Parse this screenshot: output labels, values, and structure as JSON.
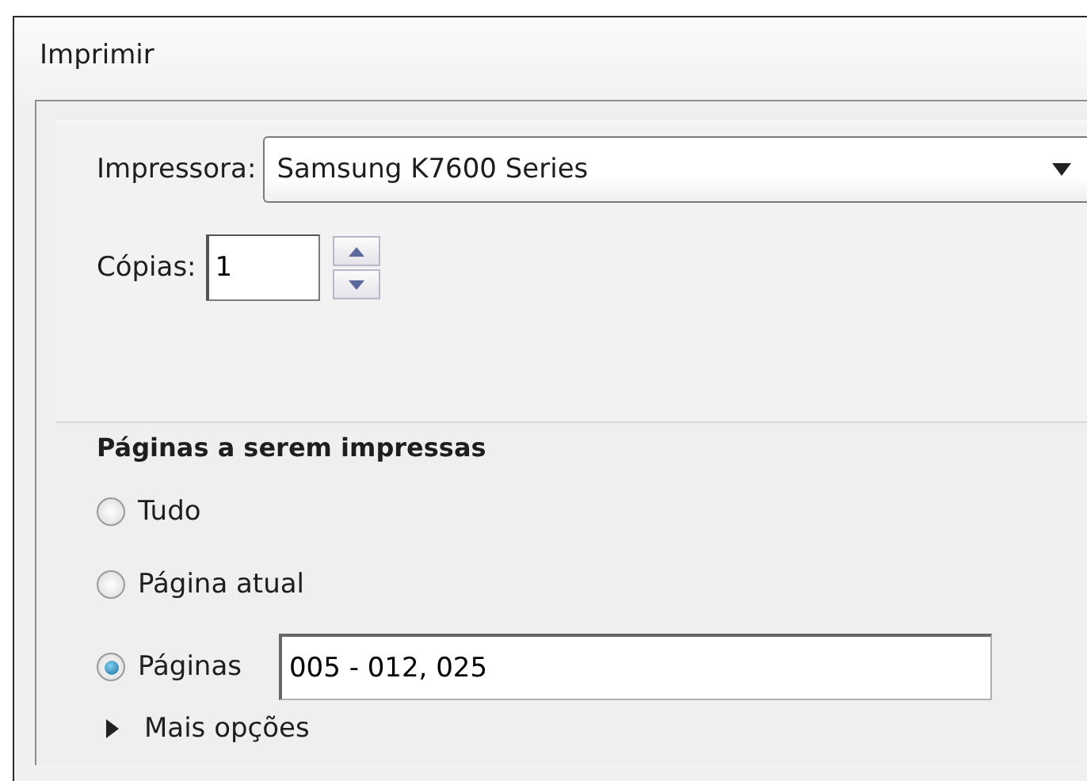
{
  "window": {
    "title": "Imprimir"
  },
  "printer": {
    "label": "Impressora:",
    "value": "Samsung K7600 Series"
  },
  "copies": {
    "label": "Cópias:",
    "value": "1"
  },
  "pages": {
    "heading": "Páginas a serem impressas",
    "options": [
      {
        "label": "Tudo",
        "selected": false
      },
      {
        "label": "Página atual",
        "selected": false
      },
      {
        "label": "Páginas",
        "selected": true,
        "value": "005 - 012, 025"
      }
    ],
    "more": {
      "label": "Mais opções",
      "expanded": false
    }
  }
}
